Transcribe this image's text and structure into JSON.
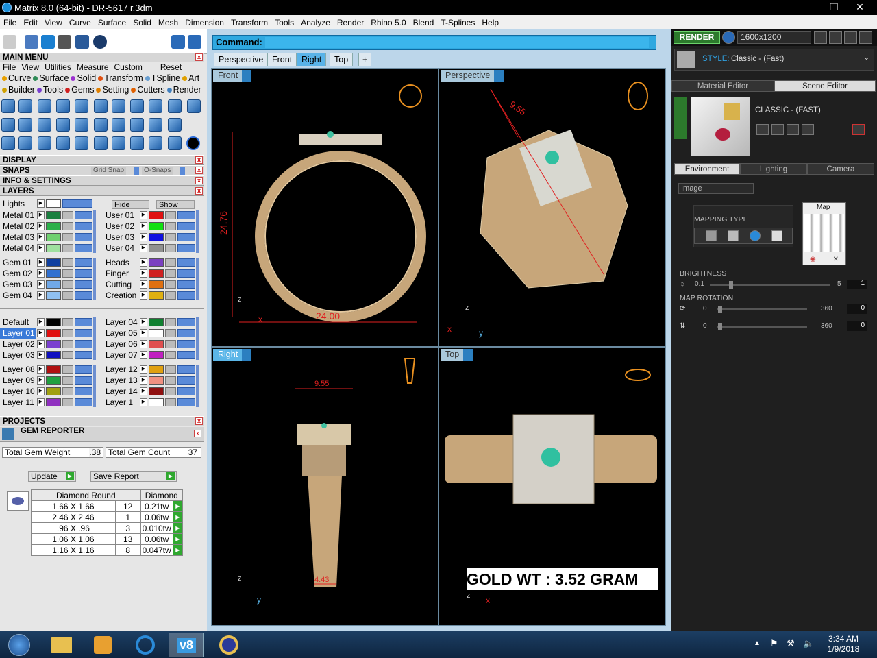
{
  "window": {
    "title": "Matrix 8.0 (64-bit) - DR-5617 r.3dm"
  },
  "menubar": [
    "File",
    "Edit",
    "View",
    "Curve",
    "Surface",
    "Solid",
    "Mesh",
    "Dimension",
    "Transform",
    "Tools",
    "Analyze",
    "Render",
    "Rhino 5.0",
    "Blend",
    "T-Splines",
    "Help"
  ],
  "left": {
    "main_menu": {
      "title": "MAIN MENU",
      "menu": [
        "File",
        "View",
        "Utilities",
        "Measure",
        "Custom"
      ],
      "reset": "Reset",
      "cats1": [
        {
          "label": "Curve",
          "color": "#e8a000"
        },
        {
          "label": "Surface",
          "color": "#2e8b57"
        },
        {
          "label": "Solid",
          "color": "#9b30d0"
        },
        {
          "label": "Transform",
          "color": "#e05010"
        },
        {
          "label": "TSpline",
          "color": "#6a9fd0"
        },
        {
          "label": "Art",
          "color": "#e0a000"
        }
      ],
      "cats2": [
        {
          "label": "Builder",
          "color": "#d0a000"
        },
        {
          "label": "Tools",
          "color": "#7a3fd0"
        },
        {
          "label": "Gems",
          "color": "#d02020"
        },
        {
          "label": "Setting",
          "color": "#e08000"
        },
        {
          "label": "Cutters",
          "color": "#e06000"
        },
        {
          "label": "Render",
          "color": "#4080c0"
        }
      ]
    },
    "sections": {
      "display": "DISPLAY",
      "snaps": "SNAPS",
      "info": "INFO & SETTINGS",
      "layers": "LAYERS",
      "projects": "PROJECTS"
    },
    "snaps": {
      "grid": "Grid Snap",
      "osnaps": "O-Snaps"
    },
    "layers_top": {
      "lights": "Lights",
      "hide": "Hide",
      "show": "Show"
    },
    "layers_left_a": [
      {
        "name": "Metal 01",
        "color": "#1a8040"
      },
      {
        "name": "Metal 02",
        "color": "#2bb04a"
      },
      {
        "name": "Metal 03",
        "color": "#6fd06f"
      },
      {
        "name": "Metal 04",
        "color": "#9fe09f"
      }
    ],
    "layers_right_a": [
      {
        "name": "User 01",
        "color": "#e01010"
      },
      {
        "name": "User 02",
        "color": "#10e010"
      },
      {
        "name": "User 03",
        "color": "#1010e0"
      },
      {
        "name": "User 04",
        "color": "#909090"
      }
    ],
    "layers_left_b": [
      {
        "name": "Gem 01",
        "color": "#1040a0"
      },
      {
        "name": "Gem 02",
        "color": "#3070d0"
      },
      {
        "name": "Gem 03",
        "color": "#70a8e8"
      },
      {
        "name": "Gem 04",
        "color": "#90c0f0"
      }
    ],
    "layers_right_b": [
      {
        "name": "Heads",
        "color": "#7a3fc0"
      },
      {
        "name": "Finger",
        "color": "#d02020"
      },
      {
        "name": "Cutting",
        "color": "#e07010"
      },
      {
        "name": "Creation",
        "color": "#e0b010"
      }
    ],
    "layers_left_c": [
      {
        "name": "Default",
        "color": "#000000"
      },
      {
        "name": "Layer 01",
        "color": "#e01010"
      },
      {
        "name": "Layer 02",
        "color": "#7a3fd0"
      },
      {
        "name": "Layer 03",
        "color": "#1010c0"
      }
    ],
    "layers_right_c": [
      {
        "name": "Layer 04",
        "color": "#108030"
      },
      {
        "name": "Layer 05",
        "color": "#ffffff"
      },
      {
        "name": "Layer 06",
        "color": "#e05050"
      },
      {
        "name": "Layer 07",
        "color": "#c020c0"
      }
    ],
    "layers_left_d": [
      {
        "name": "Layer 08",
        "color": "#b01010"
      },
      {
        "name": "Layer 09",
        "color": "#20a040"
      },
      {
        "name": "Layer 10",
        "color": "#a0a010"
      },
      {
        "name": "Layer 11",
        "color": "#9030c0"
      }
    ],
    "layers_right_d": [
      {
        "name": "Layer 12",
        "color": "#e0a010"
      },
      {
        "name": "Layer 13",
        "color": "#f09080"
      },
      {
        "name": "Layer 14",
        "color": "#901010"
      },
      {
        "name": "Layer 1",
        "color": "#ffffff"
      }
    ],
    "gem_reporter": {
      "title": "GEM REPORTER",
      "weight_label": "Total Gem Weight",
      "weight": ".38",
      "count_label": "Total Gem Count",
      "count": "37",
      "update": "Update",
      "save": "Save Report",
      "col1": "Diamond Round",
      "col2": "Diamond",
      "rows": [
        {
          "size": "1.66 X 1.66",
          "qty": "12",
          "tw": "0.21tw"
        },
        {
          "size": "2.46 X 2.46",
          "qty": "1",
          "tw": "0.06tw"
        },
        {
          "size": ".96 X .96",
          "qty": "3",
          "tw": "0.010tw"
        },
        {
          "size": "1.06 X 1.06",
          "qty": "13",
          "tw": "0.06tw"
        },
        {
          "size": "1.16 X 1.16",
          "qty": "8",
          "tw": "0.047tw"
        }
      ]
    }
  },
  "center": {
    "command_label": "Command:",
    "tabs": [
      "Perspective",
      "Front",
      "Right",
      "Top"
    ],
    "active_tab": "Right",
    "viewports": {
      "front": "Front",
      "perspective": "Perspective",
      "right": "Right",
      "top": "Top"
    },
    "dims": {
      "front_height": "24.76",
      "front_width": "24.00",
      "persp": "9.55",
      "right_top": "9.55",
      "right_bottom": "4.43"
    },
    "axes": {
      "x": "x",
      "y": "y",
      "z": "z"
    },
    "gold_label": "GOLD WT : 3.52 GRAM"
  },
  "right": {
    "render_btn": "RENDER",
    "resolution": "1600x1200",
    "style_label": "STYLE:",
    "style_value": "Classic - (Fast)",
    "tabs": [
      "Material Editor",
      "Scene Editor"
    ],
    "scene_name": "CLASSIC - (FAST)",
    "env_tabs": [
      "Environment",
      "Lighting",
      "Camera"
    ],
    "env_select": "Image",
    "mapping_label": "MAPPING TYPE",
    "map_label": "Map",
    "brightness_label": "BRIGHTNESS",
    "brightness_min": "0.1",
    "brightness_max": "5",
    "brightness_val": "1",
    "rotation_label": "MAP ROTATION",
    "rot1_min": "0",
    "rot1_max": "360",
    "rot1_val": "0",
    "rot2_min": "0",
    "rot2_max": "360",
    "rot2_val": "0"
  },
  "taskbar": {
    "time": "3:34 AM",
    "date": "1/9/2018",
    "app_label": "v8"
  }
}
